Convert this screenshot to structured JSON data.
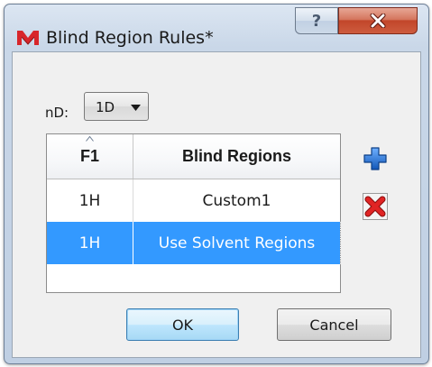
{
  "window": {
    "title": "Blind Region Rules*",
    "help_label": "?"
  },
  "nd": {
    "label": "nD:",
    "selected": "1D"
  },
  "table": {
    "columns": [
      "F1",
      "Blind Regions"
    ],
    "rows": [
      {
        "f1": "1H",
        "region": "Custom1",
        "selected": false
      },
      {
        "f1": "1H",
        "region": "Use Solvent Regions",
        "selected": true
      }
    ]
  },
  "buttons": {
    "ok": "OK",
    "cancel": "Cancel"
  },
  "icons": {
    "app": "mnova-logo-icon",
    "add": "plus-icon",
    "remove": "red-x-icon"
  },
  "colors": {
    "selection": "#3399ff",
    "add_icon": "#1f6fd1",
    "remove_icon": "#d21a1a",
    "app_icon": "#d8262b"
  }
}
